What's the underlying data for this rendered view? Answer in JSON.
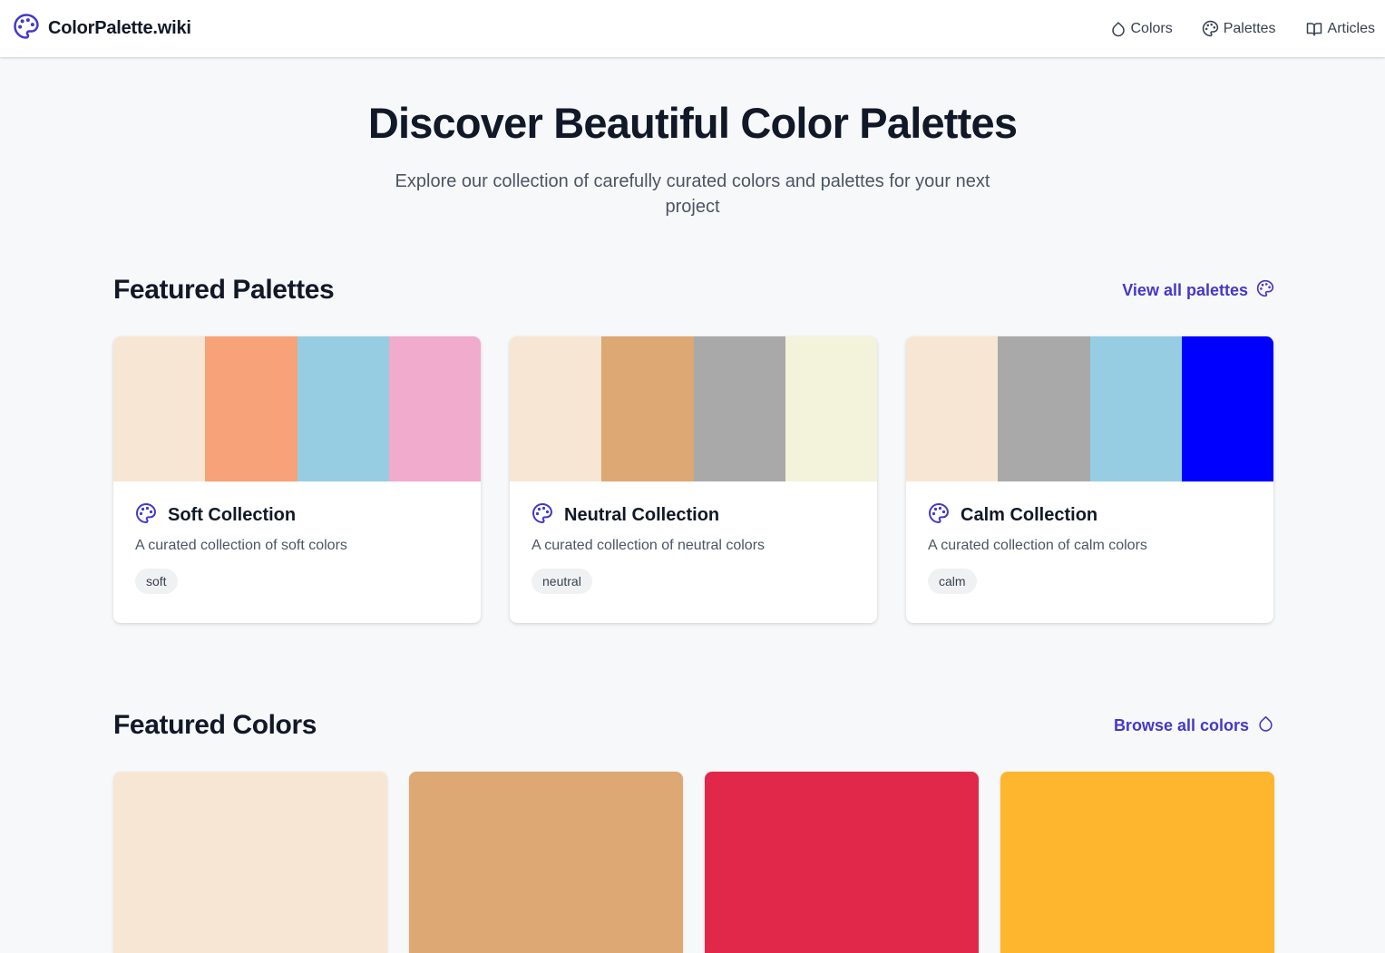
{
  "nav": {
    "brand": "ColorPalette.wiki",
    "brand_icon": "palette-icon",
    "accent": "#4338ca",
    "links": [
      {
        "label": "Colors",
        "icon": "droplet-icon"
      },
      {
        "label": "Palettes",
        "icon": "palette-icon"
      },
      {
        "label": "Articles",
        "icon": "book-open-icon"
      }
    ]
  },
  "hero": {
    "title": "Discover Beautiful Color Palettes",
    "subtitle": "Explore our collection of carefully curated colors and palettes for your next project"
  },
  "featured_palettes": {
    "title": "Featured Palettes",
    "link": "View all palettes",
    "link_icon": "palette-icon",
    "cards": [
      {
        "name": "Soft Collection",
        "description": "A curated collection of soft colors",
        "tag": "soft",
        "colors": [
          "#f8e6d4",
          "#f7a278",
          "#97cde2",
          "#f1abcd"
        ]
      },
      {
        "name": "Neutral Collection",
        "description": "A curated collection of neutral colors",
        "tag": "neutral",
        "colors": [
          "#f8e6d4",
          "#dda874",
          "#a9a9a9",
          "#f3f3dc"
        ]
      },
      {
        "name": "Calm Collection",
        "description": "A curated collection of calm colors",
        "tag": "calm",
        "colors": [
          "#f8e6d4",
          "#a9a9a9",
          "#97cde2",
          "#0000ff"
        ]
      }
    ]
  },
  "featured_colors": {
    "title": "Featured Colors",
    "link": "Browse all colors",
    "link_icon": "droplet-icon",
    "colors": [
      "#f8e6d4",
      "#dda874",
      "#e1284a",
      "#fdb62d"
    ]
  }
}
